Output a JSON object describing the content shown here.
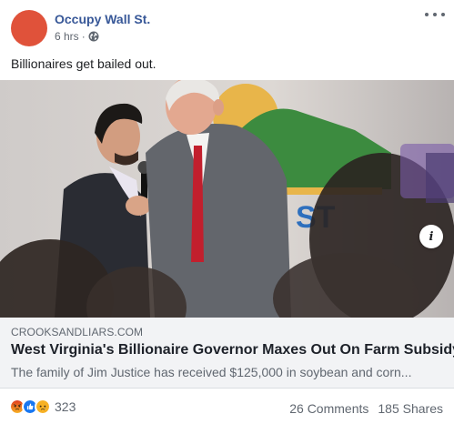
{
  "post": {
    "page_name": "Occupy Wall St.",
    "timestamp": "6 hrs",
    "separator": "·",
    "privacy_icon": "globe-icon",
    "menu_icon": "more-options-icon",
    "text": "Billionaires get bailed out.",
    "avatar_color": "#e0523a"
  },
  "link": {
    "domain": "CROOKSANDLIARS.COM",
    "title": "West Virginia's Billionaire Governor Maxes Out On Farm Subsidy",
    "description": "The family of Jim Justice has received $125,000 in soybean and corn...",
    "info_label": "i"
  },
  "footer": {
    "reaction_icons": [
      "angry-reaction-icon",
      "like-reaction-icon",
      "sad-reaction-icon"
    ],
    "reaction_count": "323",
    "comments": "26 Comments",
    "shares": "185 Shares"
  },
  "colors": {
    "page_name": "#385898",
    "secondary_text": "#606770",
    "link_meta_bg": "#f2f3f5",
    "like_blue": "#1877f2",
    "angry_orange": "#e9710f",
    "sad_yellow": "#f7b125"
  }
}
